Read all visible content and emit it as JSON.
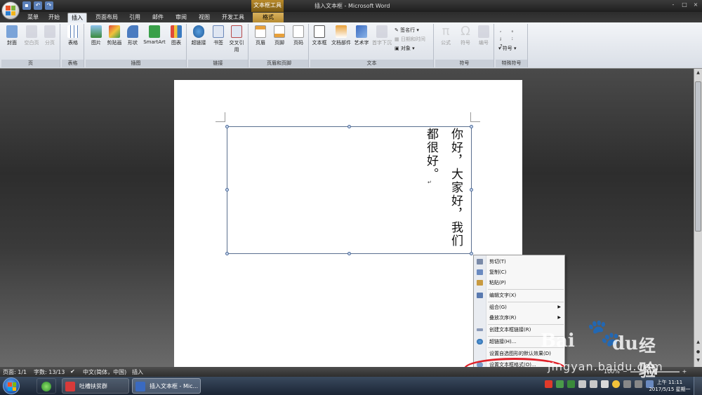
{
  "titlebar": {
    "window_title": "插入文本框 - Microsoft Word",
    "context_tool_label": "文本框工具",
    "controls": [
      "-",
      "□",
      "×"
    ]
  },
  "tabs": [
    {
      "label": "菜单"
    },
    {
      "label": "开始"
    },
    {
      "label": "插入"
    },
    {
      "label": "页面布局"
    },
    {
      "label": "引用"
    },
    {
      "label": "邮件"
    },
    {
      "label": "审阅"
    },
    {
      "label": "视图"
    },
    {
      "label": "开发工具"
    },
    {
      "label": "格式"
    }
  ],
  "active_tab": "插入",
  "ribbon": {
    "groups": [
      {
        "label": "页",
        "buttons": [
          "封面",
          "空白页",
          "分页"
        ]
      },
      {
        "label": "表格",
        "buttons": [
          "表格"
        ]
      },
      {
        "label": "插图",
        "buttons": [
          "图片",
          "剪贴画",
          "形状",
          "SmartArt",
          "图表"
        ]
      },
      {
        "label": "链接",
        "buttons": [
          "超链接",
          "书签",
          "交叉引用"
        ]
      },
      {
        "label": "页眉和页脚",
        "buttons": [
          "页眉",
          "页脚",
          "页码"
        ]
      },
      {
        "label": "文本",
        "buttons": [
          "文本框",
          "文档部件",
          "艺术字",
          "首字下沉"
        ],
        "small": [
          "签名行",
          "日期和时间",
          "对象"
        ]
      },
      {
        "label": "符号",
        "buttons": [
          "公式",
          "符号",
          "编号"
        ]
      },
      {
        "label": "特殊符号",
        "small": [
          "符号"
        ]
      }
    ]
  },
  "document": {
    "textbox_text": "你好，大家好，我们都很好。",
    "column1": "你好，大家好，我们",
    "column2": "都很好。",
    "paragraph_mark": "↵"
  },
  "context_menu": {
    "items": [
      {
        "label": "剪切(T)",
        "has_submenu": false
      },
      {
        "label": "复制(C)",
        "has_submenu": false
      },
      {
        "label": "粘贴(P)",
        "has_submenu": false
      },
      {
        "label": "编辑文字(X)",
        "has_submenu": false
      },
      {
        "label": "组合(G)",
        "has_submenu": true
      },
      {
        "label": "叠放次序(R)",
        "has_submenu": true
      },
      {
        "label": "创建文本框链接(R)",
        "has_submenu": false
      },
      {
        "label": "超链接(H)...",
        "has_submenu": false
      },
      {
        "label": "设置自选图形的默认效果(D)",
        "has_submenu": false
      },
      {
        "label": "设置文本框格式(O)...",
        "has_submenu": false
      }
    ]
  },
  "statusbar": {
    "page": "页面: 1/1",
    "words": "字数: 13/13",
    "language": "中文(简体，中国)",
    "mode": "插入",
    "zoom": "100%"
  },
  "taskbar": {
    "items": [
      {
        "label": "吐槽扶贫群"
      },
      {
        "label": "插入文本框 - Mic..."
      }
    ],
    "clock_time": "上午 11:11",
    "clock_date": "2017/5/15 星期一"
  },
  "watermark": {
    "brand_left": "Bai",
    "brand_right": "du",
    "brand_suffix": "经验",
    "url": "jingyan.baidu.com"
  }
}
